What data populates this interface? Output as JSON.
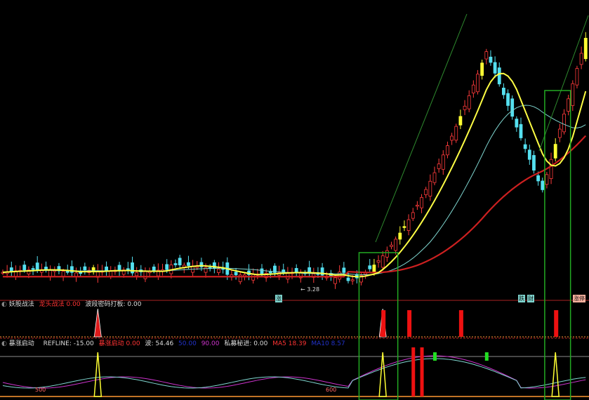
{
  "colors": {
    "background": "#000000",
    "candle_up": "#ff3b3b",
    "candle_down": "#55e0f0",
    "candle_special": "#ffff33",
    "ma_fast": "#ffff44",
    "ma_mid": "#7fd6d0",
    "ma_slow": "#cc2020",
    "box": "#22aa22",
    "separator": "#aa2222",
    "panel_text": "#cccccc"
  },
  "main_panel": {
    "low_price_label": "3.28",
    "markers": [
      "涨",
      "跌",
      "财",
      "涨停"
    ]
  },
  "panel2": {
    "indicator_name": "妖股战法",
    "field1_label": "龙头战法",
    "field1_value": "0.00",
    "field2_label": "波段密码打板",
    "field2_value": "0.00"
  },
  "panel3": {
    "indicator_name": "暴涨启动",
    "refline_label": "REFLINE",
    "refline_value": "-15.00",
    "start_label": "暴涨启动",
    "start_value": "0.00",
    "wave_label": "波",
    "wave_value": "54.46",
    "hidden1_value": "50.00",
    "hidden2_value": "90.00",
    "private_label": "私募秘进",
    "private_value": "0.00",
    "ma5_label": "MA5",
    "ma5_value": "18.39",
    "ma10_label": "MA10",
    "ma10_value": "8.57",
    "level_left": "500",
    "level_mid": "600"
  },
  "chart_data": {
    "type": "candlestick",
    "panels": [
      "price",
      "妖股战法",
      "暴涨启动"
    ],
    "price": {
      "lowest_label": 3.28,
      "series": [
        {
          "name": "",
          "kind": "moving-average",
          "color": "#ffff44"
        },
        {
          "name": "",
          "kind": "moving-average",
          "color": "#7fd6d0"
        },
        {
          "name": "",
          "kind": "moving-average",
          "color": "#cc2020"
        }
      ],
      "note_candles": "Candles are relative levels; axis values are not printed"
    },
    "panel2": {
      "signal_spikes_bar_index": [
        22,
        88
      ],
      "signal_bars_bar_index": [
        88,
        94,
        106,
        128
      ]
    },
    "panel3": {
      "refline": -15.0,
      "values": {
        "暴涨启动": 0.0,
        "波": 54.46,
        "私募秘进": 0.0,
        "MA5": 18.39,
        "MA10": 8.57
      },
      "spikes_bar_index": [
        22,
        88,
        128
      ]
    },
    "highlight_boxes_bar_range": [
      [
        83,
        91
      ],
      [
        126,
        131
      ]
    ]
  }
}
